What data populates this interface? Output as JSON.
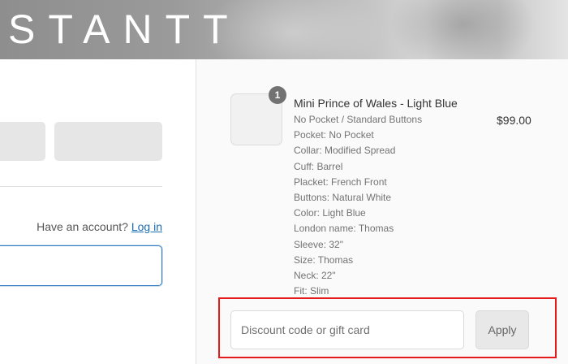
{
  "header": {
    "brand": "STANTT"
  },
  "account": {
    "prompt": "Have an account?",
    "login_label": "Log in"
  },
  "cart": {
    "quantity": "1",
    "item": {
      "title": "Mini Prince of Wales - Light Blue",
      "price": "$99.00",
      "variants": [
        "No Pocket / Standard Buttons",
        "Pocket: No Pocket",
        "Collar: Modified Spread",
        "Cuff: Barrel",
        "Placket: French Front",
        "Buttons: Natural White",
        "Color: Light Blue",
        "London name: Thomas",
        "Sleeve: 32\"",
        "Size: Thomas",
        "Neck: 22\"",
        "Fit: Slim"
      ]
    }
  },
  "discount": {
    "placeholder": "Discount code or gift card",
    "apply_label": "Apply"
  },
  "colors": {
    "highlight": "#e51a1a",
    "link": "#1d6db3",
    "focus_border": "#2f7ac2"
  }
}
